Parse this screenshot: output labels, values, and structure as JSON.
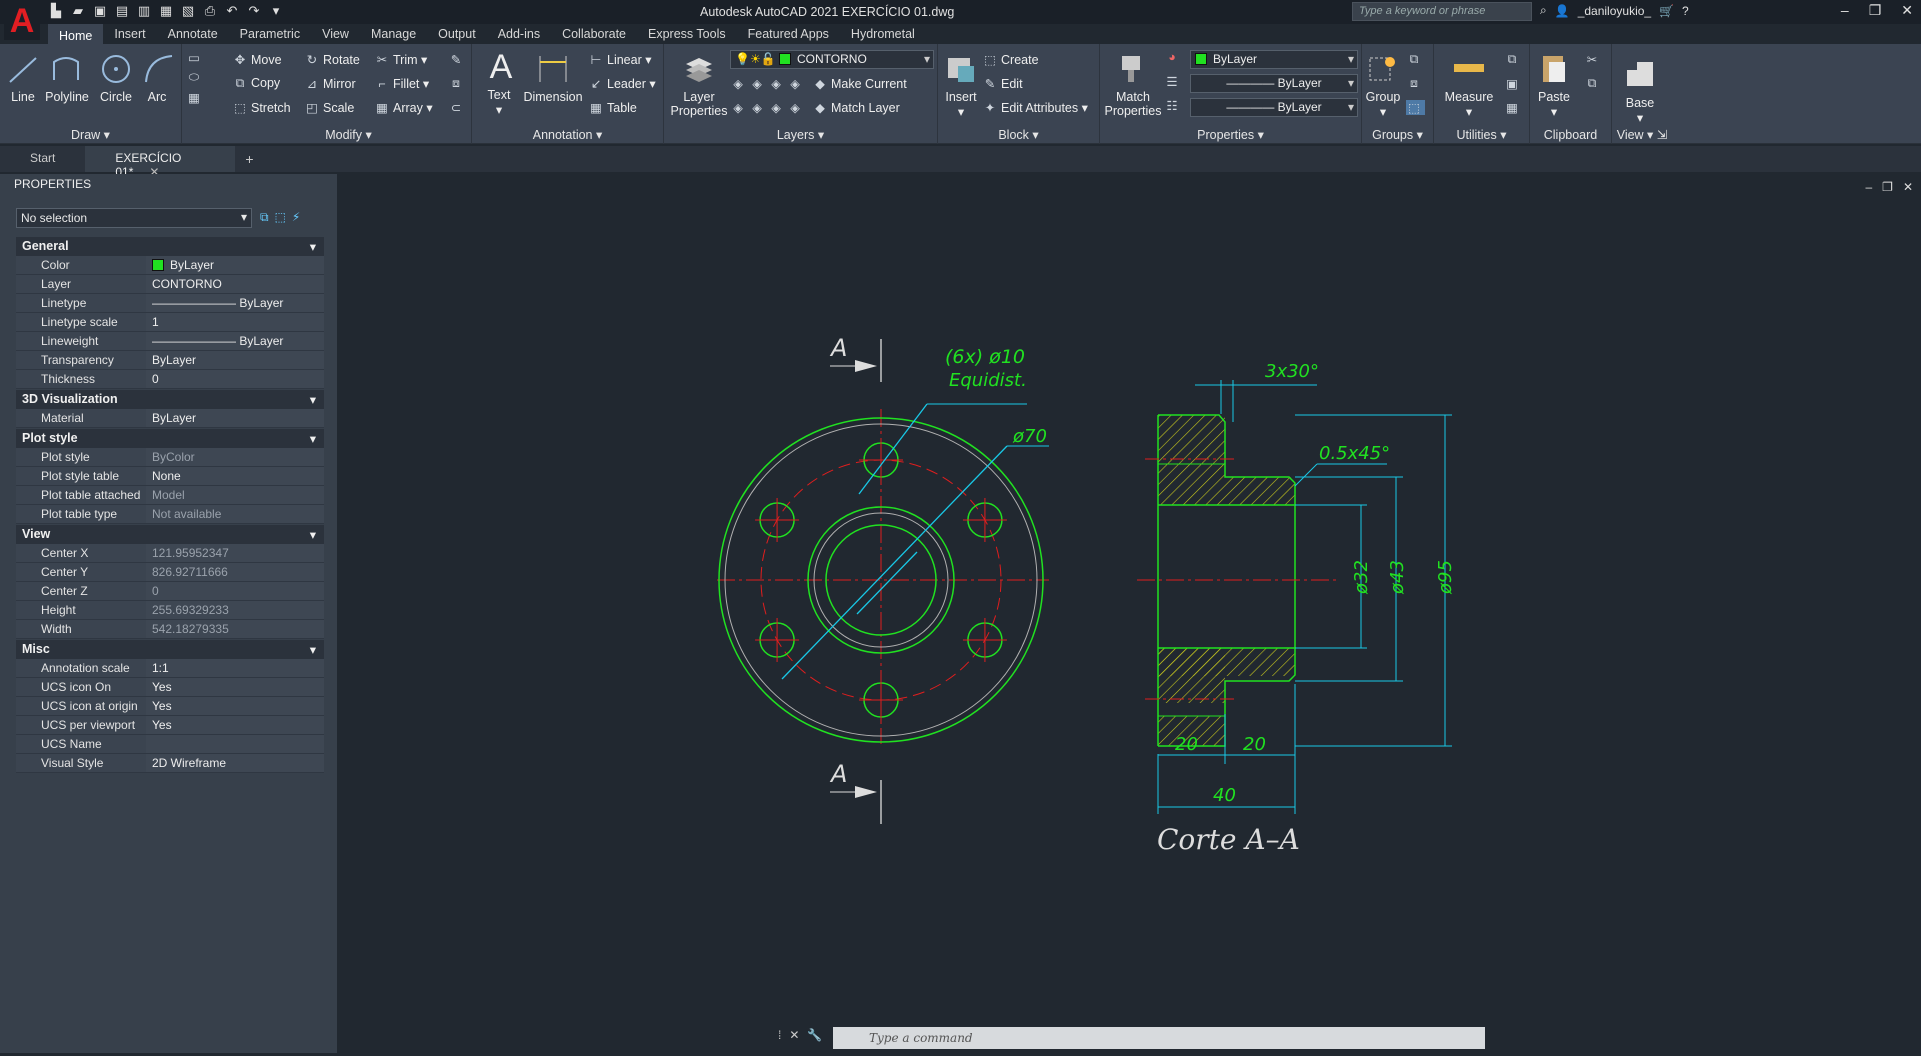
{
  "app": {
    "title": "Autodesk AutoCAD 2021    EXERCÍCIO 01.dwg",
    "logo": "A",
    "search_placeholder": "Type a keyword or phrase",
    "user": "_daniloyukio_"
  },
  "tabs": [
    "Home",
    "Insert",
    "Annotate",
    "Parametric",
    "View",
    "Manage",
    "Output",
    "Add-ins",
    "Collaborate",
    "Express Tools",
    "Featured Apps",
    "Hydrometal"
  ],
  "draw": {
    "line": "Line",
    "polyline": "Polyline",
    "circle": "Circle",
    "arc": "Arc",
    "title": "Draw"
  },
  "modify": {
    "move": "Move",
    "rotate": "Rotate",
    "trim": "Trim",
    "copy": "Copy",
    "mirror": "Mirror",
    "fillet": "Fillet",
    "stretch": "Stretch",
    "scale": "Scale",
    "array": "Array",
    "title": "Modify"
  },
  "annotation": {
    "text": "Text",
    "dimension": "Dimension",
    "linear": "Linear",
    "leader": "Leader",
    "table": "Table",
    "title": "Annotation"
  },
  "layers": {
    "layer_properties": "Layer Properties",
    "current_layer": "CONTORNO",
    "make_current": "Make Current",
    "match_layer": "Match Layer",
    "title": "Layers"
  },
  "block": {
    "insert": "Insert",
    "create": "Create",
    "edit": "Edit",
    "edit_attributes": "Edit Attributes",
    "title": "Block"
  },
  "properties": {
    "match": "Match Properties",
    "color": "ByLayer",
    "lineweight": "ByLayer",
    "linetype": "ByLayer",
    "title": "Properties"
  },
  "groups": {
    "group": "Group",
    "title": "Groups"
  },
  "utilities": {
    "measure": "Measure",
    "title": "Utilities"
  },
  "clipboard": {
    "paste": "Paste",
    "title": "Clipboard"
  },
  "view": {
    "base": "Base",
    "title": "View"
  },
  "doctabs": {
    "start": "Start",
    "active": "EXERCÍCIO 01*"
  },
  "palette": {
    "title": "PROPERTIES",
    "selection": "No selection",
    "general": {
      "title": "General",
      "rows": [
        [
          "Color",
          "ByLayer"
        ],
        [
          "Layer",
          "CONTORNO"
        ],
        [
          "Linetype",
          "ByLayer"
        ],
        [
          "Linetype scale",
          "1"
        ],
        [
          "Lineweight",
          "ByLayer"
        ],
        [
          "Transparency",
          "ByLayer"
        ],
        [
          "Thickness",
          "0"
        ]
      ]
    },
    "viz": {
      "title": "3D Visualization",
      "rows": [
        [
          "Material",
          "ByLayer"
        ]
      ]
    },
    "plot": {
      "title": "Plot style",
      "rows": [
        [
          "Plot style",
          "ByColor"
        ],
        [
          "Plot style table",
          "None"
        ],
        [
          "Plot table attached to",
          "Model"
        ],
        [
          "Plot table type",
          "Not available"
        ]
      ]
    },
    "view": {
      "title": "View",
      "rows": [
        [
          "Center X",
          "121.95952347"
        ],
        [
          "Center Y",
          "826.92711666"
        ],
        [
          "Center Z",
          "0"
        ],
        [
          "Height",
          "255.69329233"
        ],
        [
          "Width",
          "542.18279335"
        ]
      ]
    },
    "misc": {
      "title": "Misc",
      "rows": [
        [
          "Annotation scale",
          "1:1"
        ],
        [
          "UCS icon On",
          "Yes"
        ],
        [
          "UCS icon at origin",
          "Yes"
        ],
        [
          "UCS per viewport",
          "Yes"
        ],
        [
          "UCS Name",
          ""
        ],
        [
          "Visual Style",
          "2D Wireframe"
        ]
      ]
    }
  },
  "drawing": {
    "sectA": "A",
    "holes": "(6x)  ø10",
    "equidist": "Equidist.",
    "d70": "ø70",
    "chamfer1": "3x30°",
    "chamfer2": "0.5x45°",
    "d32": "ø32",
    "d43": "ø43",
    "d95": "ø95",
    "w1": "20",
    "w2": "20",
    "total": "40",
    "caption": "Corte  A–A"
  },
  "command": {
    "placeholder": "Type  a  command"
  },
  "colors": {
    "contour": "#21e121",
    "center": "#e01e1e",
    "dim": "#19c8e6",
    "hatch": "#c8c81e"
  }
}
